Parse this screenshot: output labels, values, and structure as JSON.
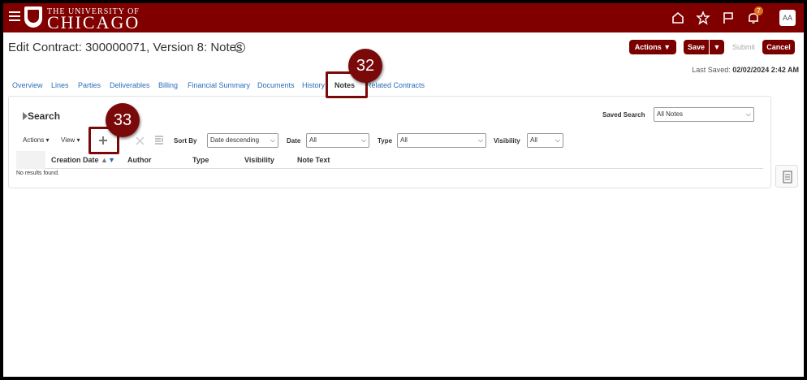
{
  "header": {
    "logo_small": "THE UNIVERSITY OF",
    "logo_big": "CHICAGO",
    "notification_count": "7",
    "avatar_initials": "AA",
    "brand_color": "#800000"
  },
  "page": {
    "title": "Edit Contract: 300000071, Version 8: Notes",
    "help_symbol": "?",
    "last_saved_label": "Last Saved:",
    "last_saved_value": "02/02/2024 2:42 AM"
  },
  "toolbar": {
    "actions_label": "Actions",
    "save_label": "Save",
    "submit_label": "Submit",
    "cancel_label": "Cancel"
  },
  "tabs": [
    {
      "label": "Overview"
    },
    {
      "label": "Lines"
    },
    {
      "label": "Parties"
    },
    {
      "label": "Deliverables"
    },
    {
      "label": "Billing"
    },
    {
      "label": "Financial Summary"
    },
    {
      "label": "Documents"
    },
    {
      "label": "History"
    },
    {
      "label": "Notes",
      "active": true
    },
    {
      "label": "Related Contracts"
    }
  ],
  "callouts": [
    "32",
    "33"
  ],
  "search": {
    "title": "Search",
    "saved_search_label": "Saved Search",
    "saved_search_value": "All Notes"
  },
  "table_toolbar": {
    "actions_label": "Actions",
    "view_label": "View",
    "sort_by_label": "Sort By",
    "sort_by_value": "Date descending",
    "date_label": "Date",
    "date_value": "All",
    "type_label": "Type",
    "type_value": "All",
    "visibility_label": "Visibility",
    "visibility_value": "All"
  },
  "table": {
    "columns": [
      "Creation Date",
      "Author",
      "Type",
      "Visibility",
      "Note Text"
    ],
    "empty_message": "No results found."
  }
}
